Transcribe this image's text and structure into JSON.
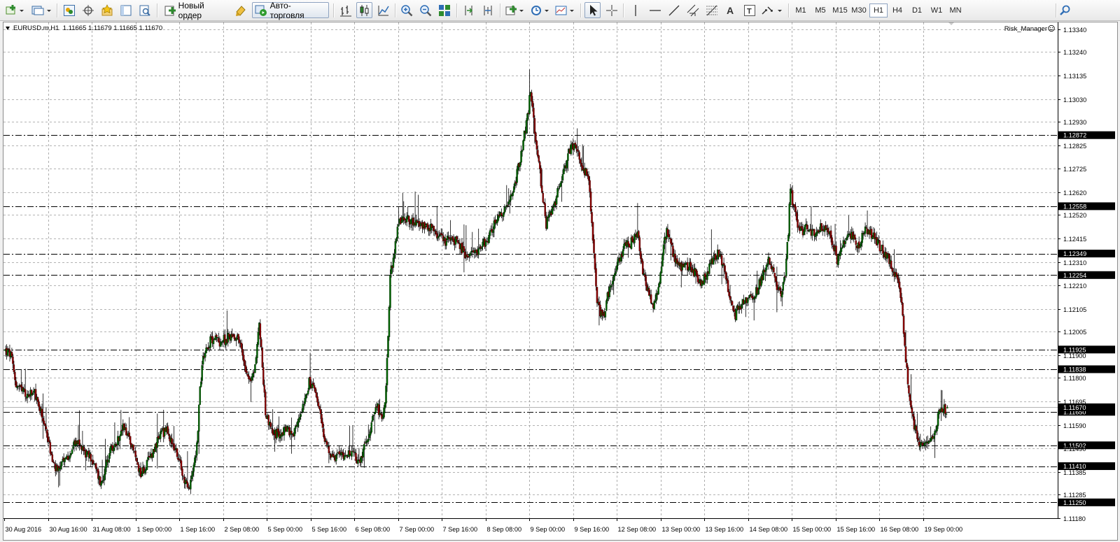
{
  "toolbar": {
    "new_order_label": "Новый ордер",
    "autotrading_label": "Авто-торговля",
    "timeframes": [
      "M1",
      "M5",
      "M15",
      "M30",
      "H1",
      "H4",
      "D1",
      "W1",
      "MN"
    ],
    "active_timeframe": "H1"
  },
  "chart": {
    "header": "EURUSD.m,H1  1.11665 1.11679 1.11665 1.11670",
    "indicator_label": "Risk_Manager",
    "colors": {
      "bull": "#006400",
      "bear": "#8b0000",
      "grid": "#9a9a9a",
      "label_bg": "#000000"
    }
  },
  "chart_data": {
    "type": "candlestick",
    "symbol": "EURUSD.m",
    "timeframe": "H1",
    "last": {
      "open": 1.11665,
      "high": 1.11679,
      "low": 1.11665,
      "close": 1.1167
    },
    "ylim": [
      1.1118,
      1.1337
    ],
    "y_ticks": [
      "1.13340",
      "1.13240",
      "1.13135",
      "1.13030",
      "1.12930",
      "1.12825",
      "1.12725",
      "1.12620",
      "1.12520",
      "1.12415",
      "1.12310",
      "1.12210",
      "1.12105",
      "1.12005",
      "1.11900",
      "1.11800",
      "1.11695",
      "1.11590",
      "1.11490",
      "1.11385",
      "1.11285",
      "1.11180"
    ],
    "x_ticks": [
      "30 Aug 2016",
      "30 Aug 16:00",
      "31 Aug 08:00",
      "1 Sep 00:00",
      "1 Sep 16:00",
      "2 Sep 08:00",
      "5 Sep 00:00",
      "5 Sep 16:00",
      "6 Sep 08:00",
      "7 Sep 00:00",
      "7 Sep 16:00",
      "8 Sep 08:00",
      "9 Sep 00:00",
      "9 Sep 16:00",
      "12 Sep 08:00",
      "13 Sep 00:00",
      "13 Sep 16:00",
      "14 Sep 08:00",
      "15 Sep 00:00",
      "15 Sep 16:00",
      "16 Sep 08:00",
      "19 Sep 00:00"
    ],
    "levels": [
      1.12872,
      1.12558,
      1.12349,
      1.12254,
      1.11925,
      1.11838,
      1.1165,
      1.11502,
      1.1141,
      1.1125
    ],
    "current_price": 1.1167,
    "close_path": [
      [
        0,
        1.1192
      ],
      [
        5,
        1.119
      ],
      [
        10,
        1.1177
      ],
      [
        20,
        1.1172
      ],
      [
        28,
        1.1173
      ],
      [
        35,
        1.1163
      ],
      [
        40,
        1.1155
      ],
      [
        45,
        1.1143
      ],
      [
        50,
        1.1138
      ],
      [
        55,
        1.1142
      ],
      [
        62,
        1.1147
      ],
      [
        68,
        1.1152
      ],
      [
        72,
        1.115
      ],
      [
        78,
        1.1146
      ],
      [
        82,
        1.1145
      ],
      [
        88,
        1.1138
      ],
      [
        92,
        1.1133
      ],
      [
        96,
        1.114
      ],
      [
        100,
        1.1147
      ],
      [
        105,
        1.115
      ],
      [
        110,
        1.1155
      ],
      [
        113,
        1.1158
      ],
      [
        118,
        1.1155
      ],
      [
        122,
        1.115
      ],
      [
        126,
        1.1143
      ],
      [
        130,
        1.1138
      ],
      [
        134,
        1.114
      ],
      [
        140,
        1.1146
      ],
      [
        146,
        1.1152
      ],
      [
        150,
        1.1155
      ],
      [
        154,
        1.1157
      ],
      [
        158,
        1.1154
      ],
      [
        162,
        1.115
      ],
      [
        166,
        1.1145
      ],
      [
        170,
        1.1138
      ],
      [
        174,
        1.1133
      ],
      [
        177,
        1.1131
      ],
      [
        180,
        1.114
      ],
      [
        184,
        1.115
      ],
      [
        187,
        1.1175
      ],
      [
        190,
        1.119
      ],
      [
        195,
        1.1195
      ],
      [
        200,
        1.1198
      ],
      [
        206,
        1.1196
      ],
      [
        212,
        1.1197
      ],
      [
        218,
        1.1199
      ],
      [
        224,
        1.1198
      ],
      [
        228,
        1.119
      ],
      [
        232,
        1.1183
      ],
      [
        236,
        1.1178
      ],
      [
        240,
        1.1185
      ],
      [
        244,
        1.1205
      ],
      [
        247,
        1.1185
      ],
      [
        250,
        1.1165
      ],
      [
        255,
        1.1158
      ],
      [
        260,
        1.1155
      ],
      [
        266,
        1.1156
      ],
      [
        272,
        1.1158
      ],
      [
        276,
        1.1153
      ],
      [
        280,
        1.1158
      ],
      [
        284,
        1.1165
      ],
      [
        288,
        1.1172
      ],
      [
        292,
        1.1178
      ],
      [
        296,
        1.1175
      ],
      [
        300,
        1.117
      ],
      [
        304,
        1.116
      ],
      [
        308,
        1.1152
      ],
      [
        312,
        1.1146
      ],
      [
        316,
        1.1145
      ],
      [
        322,
        1.1146
      ],
      [
        328,
        1.1147
      ],
      [
        334,
        1.1146
      ],
      [
        338,
        1.1144
      ],
      [
        342,
        1.1145
      ],
      [
        346,
        1.115
      ],
      [
        350,
        1.1157
      ],
      [
        354,
        1.1163
      ],
      [
        358,
        1.1167
      ],
      [
        362,
        1.116
      ],
      [
        366,
        1.1175
      ],
      [
        370,
        1.1225
      ],
      [
        374,
        1.1235
      ],
      [
        378,
        1.1248
      ],
      [
        382,
        1.1252
      ],
      [
        386,
        1.125
      ],
      [
        392,
        1.1249
      ],
      [
        398,
        1.1246
      ],
      [
        404,
        1.1248
      ],
      [
        410,
        1.1246
      ],
      [
        416,
        1.1243
      ],
      [
        422,
        1.124
      ],
      [
        428,
        1.1242
      ],
      [
        434,
        1.124
      ],
      [
        440,
        1.1236
      ],
      [
        446,
        1.1233
      ],
      [
        452,
        1.1235
      ],
      [
        458,
        1.1238
      ],
      [
        464,
        1.1242
      ],
      [
        470,
        1.1248
      ],
      [
        476,
        1.1252
      ],
      [
        482,
        1.1255
      ],
      [
        488,
        1.1262
      ],
      [
        492,
        1.127
      ],
      [
        496,
        1.128
      ],
      [
        500,
        1.129
      ],
      [
        503,
        1.1298
      ],
      [
        505,
        1.1308
      ],
      [
        507,
        1.1298
      ],
      [
        510,
        1.1286
      ],
      [
        513,
        1.1275
      ],
      [
        516,
        1.1262
      ],
      [
        520,
        1.1248
      ],
      [
        524,
        1.1252
      ],
      [
        528,
        1.1256
      ],
      [
        532,
        1.1265
      ],
      [
        536,
        1.127
      ],
      [
        540,
        1.1276
      ],
      [
        544,
        1.1282
      ],
      [
        548,
        1.1283
      ],
      [
        552,
        1.1278
      ],
      [
        556,
        1.1272
      ],
      [
        560,
        1.127
      ],
      [
        563,
        1.1255
      ],
      [
        566,
        1.1235
      ],
      [
        569,
        1.1215
      ],
      [
        572,
        1.1208
      ],
      [
        575,
        1.1207
      ],
      [
        580,
        1.1218
      ],
      [
        585,
        1.1225
      ],
      [
        590,
        1.1232
      ],
      [
        596,
        1.1238
      ],
      [
        602,
        1.124
      ],
      [
        608,
        1.1245
      ],
      [
        612,
        1.123
      ],
      [
        616,
        1.1222
      ],
      [
        620,
        1.1215
      ],
      [
        624,
        1.1212
      ],
      [
        628,
        1.122
      ],
      [
        632,
        1.1235
      ],
      [
        636,
        1.1245
      ],
      [
        640,
        1.1238
      ],
      [
        645,
        1.1232
      ],
      [
        650,
        1.1228
      ],
      [
        655,
        1.123
      ],
      [
        660,
        1.1228
      ],
      [
        665,
        1.1225
      ],
      [
        670,
        1.1222
      ],
      [
        675,
        1.1226
      ],
      [
        680,
        1.1232
      ],
      [
        685,
        1.1235
      ],
      [
        690,
        1.123
      ],
      [
        694,
        1.1222
      ],
      [
        698,
        1.1213
      ],
      [
        702,
        1.1208
      ],
      [
        706,
        1.1212
      ],
      [
        710,
        1.1214
      ],
      [
        716,
        1.1216
      ],
      [
        722,
        1.1218
      ],
      [
        728,
        1.1225
      ],
      [
        734,
        1.1232
      ],
      [
        738,
        1.1228
      ],
      [
        742,
        1.122
      ],
      [
        746,
        1.1218
      ],
      [
        750,
        1.1225
      ],
      [
        753,
        1.1245
      ],
      [
        755,
        1.1265
      ],
      [
        758,
        1.1255
      ],
      [
        762,
        1.1248
      ],
      [
        766,
        1.1245
      ],
      [
        772,
        1.1246
      ],
      [
        778,
        1.1244
      ],
      [
        784,
        1.1246
      ],
      [
        790,
        1.1245
      ],
      [
        796,
        1.124
      ],
      [
        800,
        1.1232
      ],
      [
        805,
        1.1238
      ],
      [
        810,
        1.1244
      ],
      [
        815,
        1.1242
      ],
      [
        820,
        1.1238
      ],
      [
        826,
        1.1245
      ],
      [
        832,
        1.1244
      ],
      [
        838,
        1.124
      ],
      [
        844,
        1.1236
      ],
      [
        850,
        1.1232
      ],
      [
        854,
        1.1228
      ],
      [
        858,
        1.1222
      ],
      [
        862,
        1.1215
      ],
      [
        864,
        1.12
      ],
      [
        866,
        1.1188
      ],
      [
        868,
        1.1178
      ],
      [
        871,
        1.1168
      ],
      [
        874,
        1.1158
      ],
      [
        877,
        1.1155
      ],
      [
        880,
        1.115
      ],
      [
        884,
        1.1152
      ],
      [
        888,
        1.115
      ],
      [
        892,
        1.1155
      ],
      [
        896,
        1.116
      ],
      [
        899,
        1.1167
      ],
      [
        902,
        1.1166
      ],
      [
        905,
        1.1166
      ]
    ]
  }
}
